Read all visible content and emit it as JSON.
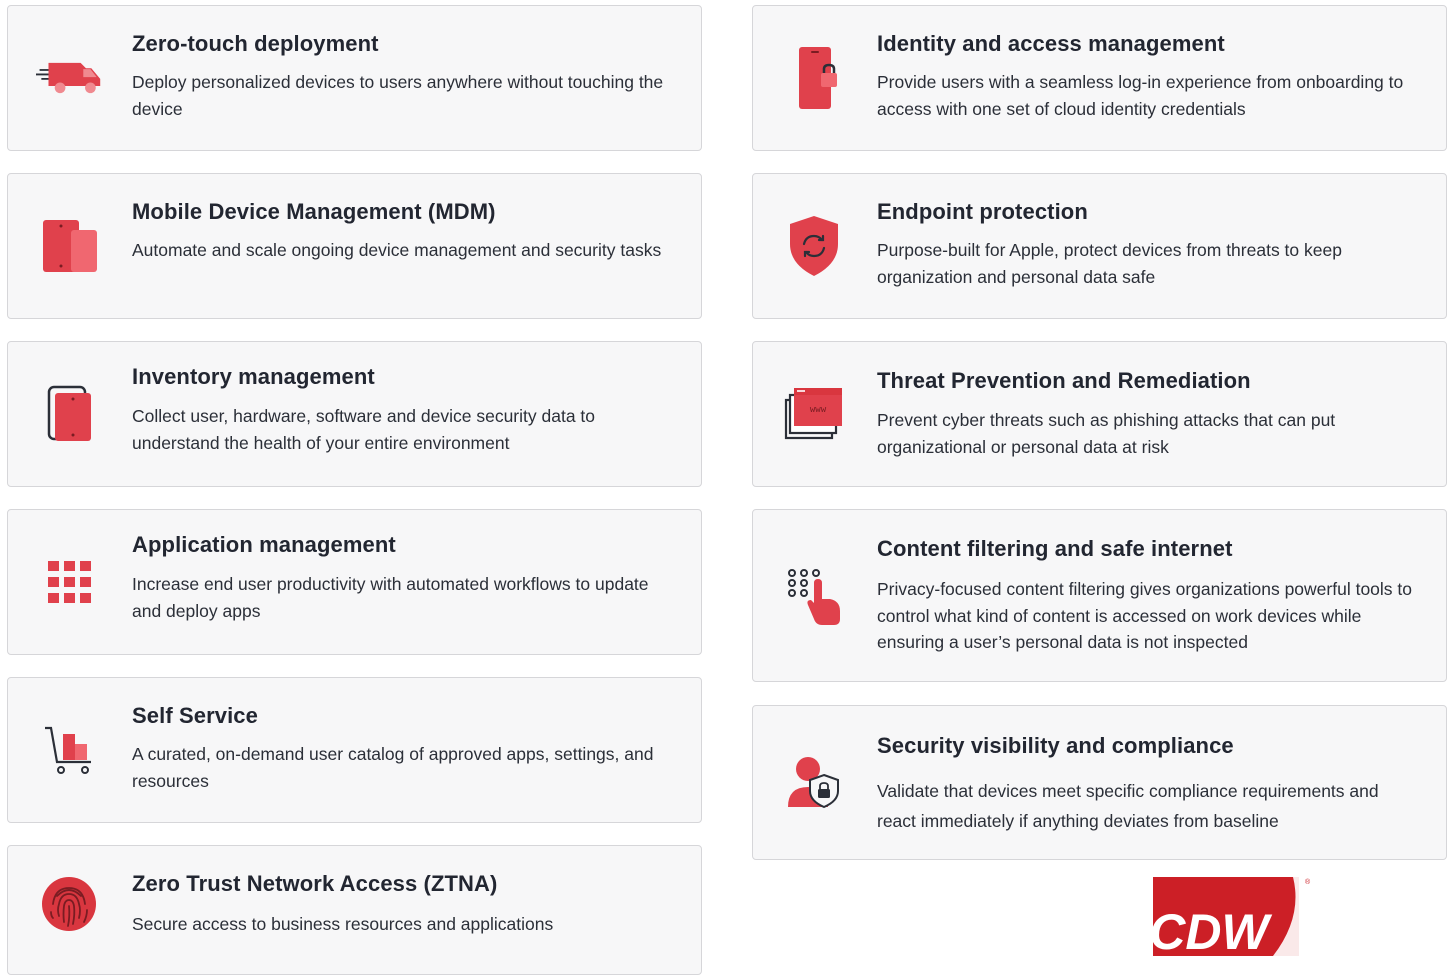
{
  "accent": "#e0414c",
  "left_cards": [
    {
      "title": "Zero-touch deployment",
      "desc": "Deploy personalized devices to users anywhere without touching the device",
      "icon": "truck-icon"
    },
    {
      "title": "Mobile Device Management (MDM)",
      "desc": "Automate and scale ongoing device management and security tasks",
      "icon": "devices-icon"
    },
    {
      "title": "Inventory management",
      "desc": "Collect user, hardware, software and device security data to understand the health of your entire environment",
      "icon": "tablet-stack-icon"
    },
    {
      "title": "Application management",
      "desc": "Increase end user productivity with automated workflows to update and deploy apps",
      "icon": "app-grid-icon"
    },
    {
      "title": "Self Service",
      "desc": "A curated, on-demand user catalog of approved apps, settings, and resources",
      "icon": "cart-icon"
    },
    {
      "title": "Zero Trust Network Access (ZTNA)",
      "desc": "Secure access to business resources and applications",
      "icon": "fingerprint-icon"
    }
  ],
  "right_cards": [
    {
      "title": "Identity and access management",
      "desc": "Provide users with a seamless log-in experience from onboarding to access with one set of cloud identity credentials",
      "icon": "phone-lock-icon"
    },
    {
      "title": "Endpoint protection",
      "desc": "Purpose-built for Apple, protect devices from threats to keep organization and personal data safe",
      "icon": "shield-sync-icon"
    },
    {
      "title": "Threat Prevention and Remediation",
      "desc": "Prevent cyber threats such as phishing attacks that can put organizational or personal data at risk",
      "icon": "browser-stack-icon"
    },
    {
      "title": "Content filtering and safe internet",
      "desc": "Privacy-focused content filtering gives organizations powerful tools to control what kind of content is accessed on work devices while ensuring a user’s personal data is not inspected",
      "icon": "touch-keypad-icon"
    },
    {
      "title": "Security visibility and compliance",
      "desc": "Validate that devices meet specific compliance requirements and react immediately if anything deviates from baseline",
      "icon": "user-shield-icon"
    }
  ],
  "logo": {
    "text": "CDW",
    "mark": "®"
  }
}
